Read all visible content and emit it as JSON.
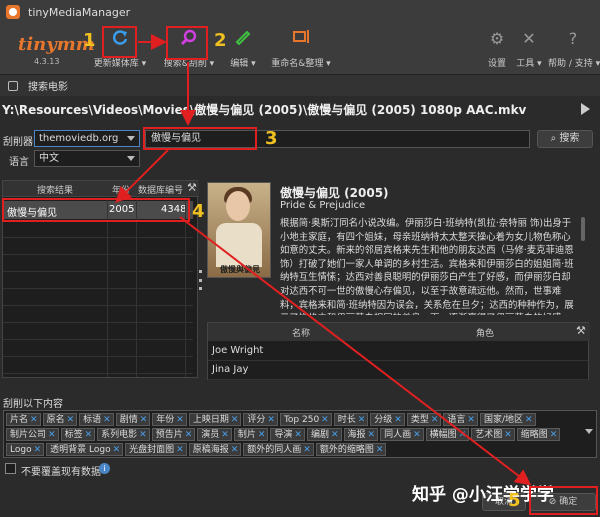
{
  "window": {
    "title": "tinyMediaManager"
  },
  "toolbar": {
    "logo": "tinymm",
    "version": "4.3.13",
    "buttons": [
      {
        "name": "update-library",
        "label": "更新媒体库 ▾",
        "icon": "refresh-icon",
        "color": "#3a9ff0"
      },
      {
        "name": "search-scrape",
        "label": "搜索&刮削 ▾",
        "icon": "search-icon",
        "color": "#d040e0"
      },
      {
        "name": "edit",
        "label": "编辑 ▾",
        "icon": "pencil-icon",
        "color": "#40c040"
      },
      {
        "name": "rename-tidy",
        "label": "重命名&整理 ▾",
        "icon": "rename-icon",
        "color": "#e8772e"
      },
      {
        "name": "settings",
        "label": "设置",
        "icon": "gear-icon"
      },
      {
        "name": "tools",
        "label": "工具 ▾",
        "icon": "wrench-icon"
      },
      {
        "name": "help",
        "label": "帮助 / 支持 ▾",
        "icon": "help-icon"
      }
    ]
  },
  "dialog": {
    "title": "搜索电影",
    "file_path": "Y:\\Resources\\Videos\\Movies\\傲慢与偏见 (2005)\\傲慢与偏见 (2005) 1080p AAC.mkv",
    "scraper_label": "刮削器",
    "scraper_value": "themoviedb.org",
    "language_label": "语言",
    "language_value": "中文",
    "search_query": "傲慢与偏见",
    "search_button": "搜索"
  },
  "results": {
    "columns": [
      "搜索结果",
      "年份",
      "数据库编号"
    ],
    "rows": [
      {
        "title": "傲慢与偏见",
        "year": "2005",
        "id": "4348"
      }
    ]
  },
  "movie": {
    "title": "傲慢与偏见 (2005)",
    "original_title": "Pride & Prejudice",
    "poster_text": "傲慢與偏見",
    "plot": "根据简·奥斯汀同名小说改编。伊丽莎白·班纳特(凯拉·奈特丽 饰)出身于小地主家庭，有四个姐妹，母亲班纳特太太整天操心着为女儿物色称心如意的丈夫。新来的邻居宾格来先生和他的朋友达西（马修·麦克菲迪恩 饰）打破了她们一家人单调的乡村生活。宾格来和伊丽莎白的姐姐简·班纳特互生情愫；达西对善良聪明的伊丽莎白产生了好感，而伊丽莎白却对达西不可一世的傲慢心存偏见，以至于故意疏远他。然而，世事难料，宾格来和简·班纳特因为误会，关系危在旦夕；达西的种种作为，展示了性格中和伊丽莎白相同的善良一面，逐渐赢得了伊丽莎白的好感。两对有情人能否"
  },
  "cast": {
    "columns": [
      "名称",
      "角色"
    ],
    "rows": [
      {
        "name": "Joe Wright",
        "role": ""
      },
      {
        "name": "Jina Jay",
        "role": ""
      }
    ]
  },
  "scrape": {
    "label": "刮削以下内容",
    "tags": [
      "片名",
      "原名",
      "标语",
      "剧情",
      "年份",
      "上映日期",
      "评分",
      "Top 250",
      "时长",
      "分级",
      "类型",
      "语言",
      "国家/地区",
      "制片公司",
      "标签",
      "系列电影",
      "预告片",
      "演员",
      "制片",
      "导演",
      "编剧",
      "海报",
      "同人画",
      "横幅图",
      "艺术图",
      "缩略图",
      "Logo",
      "透明背景 Logo",
      "光盘封面图",
      "原稿海报",
      "额外的同人画",
      "额外的缩略图"
    ],
    "overwrite_label": "不要覆盖现有数据"
  },
  "buttons": {
    "cancel": "取消",
    "ok": "确定"
  },
  "watermark": "知乎 @小汪学学学",
  "annotations": [
    "1",
    "2",
    "3",
    "4",
    "5"
  ]
}
